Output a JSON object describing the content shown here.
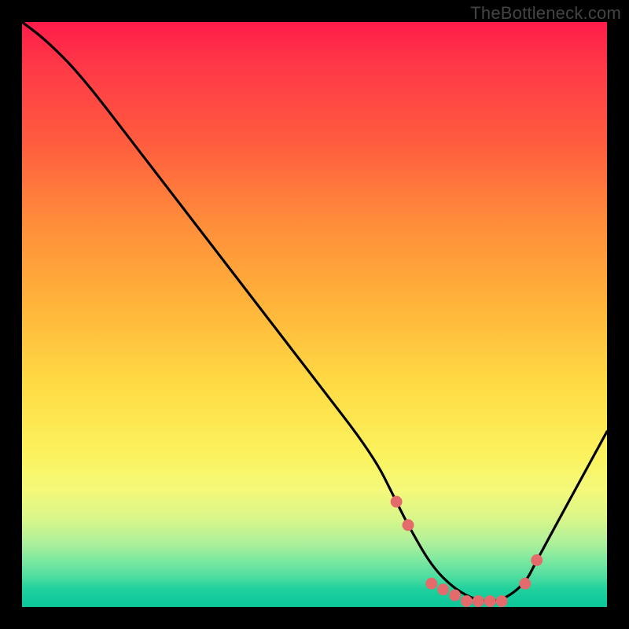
{
  "attribution_text": "TheBottleneck.com",
  "chart_data": {
    "type": "line",
    "title": "",
    "xlabel": "",
    "ylabel": "",
    "xlim": [
      0,
      100
    ],
    "ylim": [
      0,
      100
    ],
    "x": [
      0,
      4,
      10,
      20,
      30,
      40,
      50,
      60,
      64,
      66,
      70,
      74,
      78,
      82,
      86,
      88,
      100
    ],
    "values": [
      100,
      97,
      91,
      78,
      65,
      52,
      39,
      26,
      18,
      14,
      7,
      3,
      1,
      1,
      4,
      8,
      30
    ],
    "marked_points": {
      "x": [
        64,
        66,
        70,
        72,
        74,
        76,
        78,
        80,
        82,
        86,
        88
      ],
      "y": [
        18,
        14,
        4,
        3,
        2,
        1,
        1,
        1,
        1,
        4,
        8
      ]
    },
    "gradient_stops": [
      {
        "pos": 0.0,
        "color": "#ff1c4a"
      },
      {
        "pos": 0.2,
        "color": "#ff5a3f"
      },
      {
        "pos": 0.48,
        "color": "#ffb33a"
      },
      {
        "pos": 0.74,
        "color": "#fbf35e"
      },
      {
        "pos": 0.92,
        "color": "#7de8a0"
      },
      {
        "pos": 1.0,
        "color": "#0cc79a"
      }
    ]
  }
}
